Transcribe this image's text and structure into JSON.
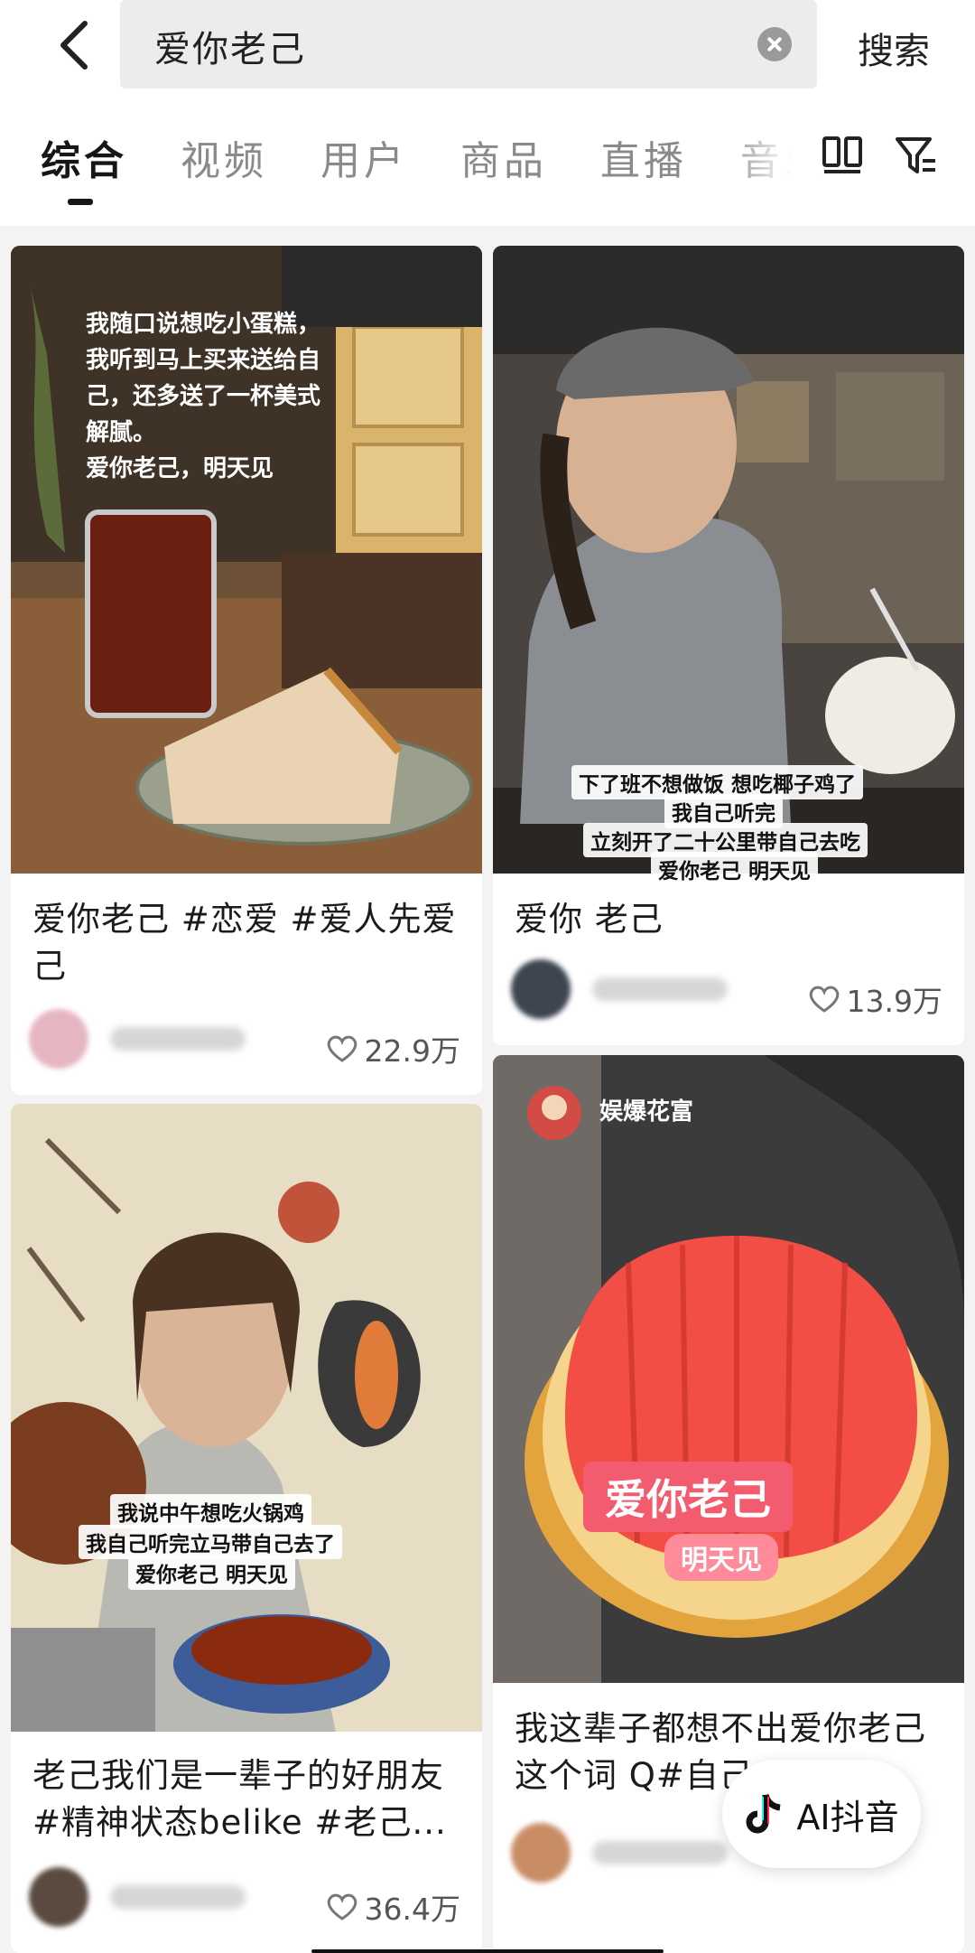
{
  "header": {
    "search_query": "爱你老己",
    "search_button": "搜索"
  },
  "tabs": [
    {
      "label": "综合"
    },
    {
      "label": "视频"
    },
    {
      "label": "用户"
    },
    {
      "label": "商品"
    },
    {
      "label": "直播"
    },
    {
      "label": "音乐"
    }
  ],
  "cards": [
    {
      "title": "爱你老己 #恋爱 #爱人先爱己",
      "likes": "22.9万",
      "captions": [
        "我随口说想吃小蛋糕，",
        "我听到马上买来送给自",
        "己，还多送了一杯美式",
        "解腻。",
        "爱你老己，明天见"
      ]
    },
    {
      "title": "爱你 老己",
      "likes": "13.9万",
      "captions": [
        "下了班不想做饭 想吃椰子鸡了",
        "我自己听完",
        "立刻开了二十公里带自己去吃",
        "爱你老己 明天见"
      ]
    },
    {
      "title": "老己我们是一辈子的好朋友 #精神状态belike #老己...",
      "likes": "36.4万",
      "captions": [
        "我说中午想吃火锅鸡",
        "我自己听完立马带自己去了",
        "爱你老己 明天见"
      ]
    },
    {
      "title": "我这辈子都想不出爱你老己这个词 Q#自己",
      "channel": "娱爆花富",
      "overlay_title": "爱你老己",
      "overlay_sub": "明天见"
    }
  ],
  "ai_button": {
    "label": "AI抖音"
  },
  "colors": {
    "accent": "#161616",
    "background": "#f3f3f3"
  }
}
